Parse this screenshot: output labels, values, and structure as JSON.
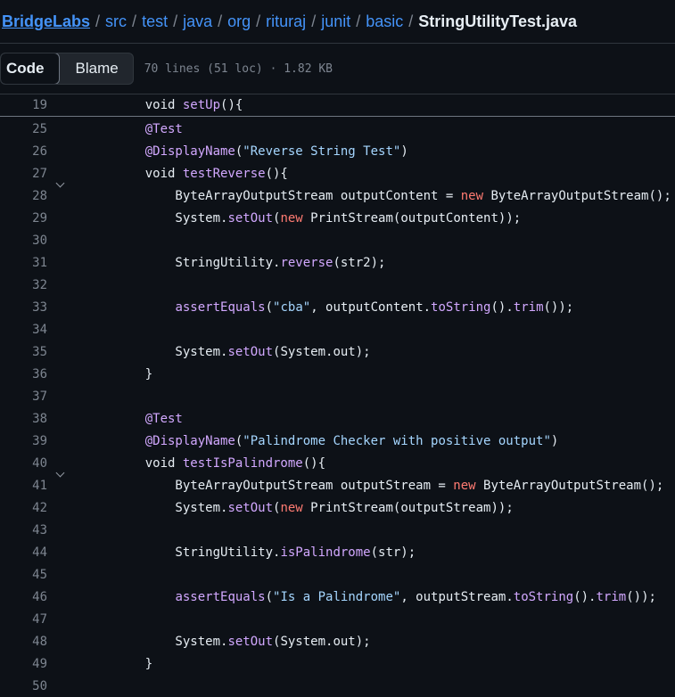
{
  "breadcrumb": {
    "segments": [
      "BridgeLabs",
      "src",
      "test",
      "java",
      "org",
      "rituraj",
      "junit",
      "basic"
    ],
    "separator": "/",
    "file": "StringUtilityTest.java"
  },
  "toolbar": {
    "code_label": "Code",
    "blame_label": "Blame",
    "file_info": "70 lines (51 loc) · 1.82 KB"
  },
  "code": {
    "sticky": {
      "num": "19",
      "tokens": [
        [
          "",
          "    void "
        ],
        [
          "fn",
          "setUp"
        ],
        [
          "",
          "(){"
        ]
      ]
    },
    "lines": [
      {
        "num": "25",
        "tokens": [
          [
            "an",
            "    @Test"
          ]
        ]
      },
      {
        "num": "26",
        "tokens": [
          [
            "an",
            "    @DisplayName"
          ],
          [
            "",
            "("
          ],
          [
            "str",
            "\"Reverse String Test\""
          ],
          [
            "",
            ")"
          ]
        ]
      },
      {
        "num": "27",
        "fold": true,
        "tokens": [
          [
            "",
            "    void "
          ],
          [
            "fn",
            "testReverse"
          ],
          [
            "",
            "(){"
          ]
        ]
      },
      {
        "num": "28",
        "tokens": [
          [
            "",
            "        ByteArrayOutputStream outputContent = "
          ],
          [
            "kw",
            "new"
          ],
          [
            "",
            " ByteArrayOutputStream();"
          ]
        ]
      },
      {
        "num": "29",
        "tokens": [
          [
            "",
            "        System."
          ],
          [
            "fn",
            "setOut"
          ],
          [
            "",
            "("
          ],
          [
            "kw",
            "new"
          ],
          [
            "",
            " PrintStream(outputContent));"
          ]
        ]
      },
      {
        "num": "30",
        "tokens": []
      },
      {
        "num": "31",
        "tokens": [
          [
            "",
            "        StringUtility."
          ],
          [
            "fn",
            "reverse"
          ],
          [
            "",
            "(str2);"
          ]
        ]
      },
      {
        "num": "32",
        "tokens": []
      },
      {
        "num": "33",
        "tokens": [
          [
            "",
            "        "
          ],
          [
            "fn",
            "assertEquals"
          ],
          [
            "",
            "("
          ],
          [
            "str",
            "\"cba\""
          ],
          [
            "",
            ", outputContent."
          ],
          [
            "fn",
            "toString"
          ],
          [
            "",
            "()."
          ],
          [
            "fn",
            "trim"
          ],
          [
            "",
            "());"
          ]
        ]
      },
      {
        "num": "34",
        "tokens": []
      },
      {
        "num": "35",
        "tokens": [
          [
            "",
            "        System."
          ],
          [
            "fn",
            "setOut"
          ],
          [
            "",
            "(System.out);"
          ]
        ]
      },
      {
        "num": "36",
        "tokens": [
          [
            "",
            "    }"
          ]
        ]
      },
      {
        "num": "37",
        "tokens": []
      },
      {
        "num": "38",
        "tokens": [
          [
            "an",
            "    @Test"
          ]
        ]
      },
      {
        "num": "39",
        "tokens": [
          [
            "an",
            "    @DisplayName"
          ],
          [
            "",
            "("
          ],
          [
            "str",
            "\"Palindrome Checker with positive output\""
          ],
          [
            "",
            ")"
          ]
        ]
      },
      {
        "num": "40",
        "fold": true,
        "tokens": [
          [
            "",
            "    void "
          ],
          [
            "fn",
            "testIsPalindrome"
          ],
          [
            "",
            "(){"
          ]
        ]
      },
      {
        "num": "41",
        "tokens": [
          [
            "",
            "        ByteArrayOutputStream outputStream = "
          ],
          [
            "kw",
            "new"
          ],
          [
            "",
            " ByteArrayOutputStream();"
          ]
        ]
      },
      {
        "num": "42",
        "tokens": [
          [
            "",
            "        System."
          ],
          [
            "fn",
            "setOut"
          ],
          [
            "",
            "("
          ],
          [
            "kw",
            "new"
          ],
          [
            "",
            " PrintStream(outputStream));"
          ]
        ]
      },
      {
        "num": "43",
        "tokens": []
      },
      {
        "num": "44",
        "tokens": [
          [
            "",
            "        StringUtility."
          ],
          [
            "fn",
            "isPalindrome"
          ],
          [
            "",
            "(str);"
          ]
        ]
      },
      {
        "num": "45",
        "tokens": []
      },
      {
        "num": "46",
        "tokens": [
          [
            "",
            "        "
          ],
          [
            "fn",
            "assertEquals"
          ],
          [
            "",
            "("
          ],
          [
            "str",
            "\"Is a Palindrome\""
          ],
          [
            "",
            ", outputStream."
          ],
          [
            "fn",
            "toString"
          ],
          [
            "",
            "()."
          ],
          [
            "fn",
            "trim"
          ],
          [
            "",
            "());"
          ]
        ]
      },
      {
        "num": "47",
        "tokens": []
      },
      {
        "num": "48",
        "tokens": [
          [
            "",
            "        System."
          ],
          [
            "fn",
            "setOut"
          ],
          [
            "",
            "(System.out);"
          ]
        ]
      },
      {
        "num": "49",
        "tokens": [
          [
            "",
            "    }"
          ]
        ]
      },
      {
        "num": "50",
        "tokens": []
      }
    ]
  }
}
